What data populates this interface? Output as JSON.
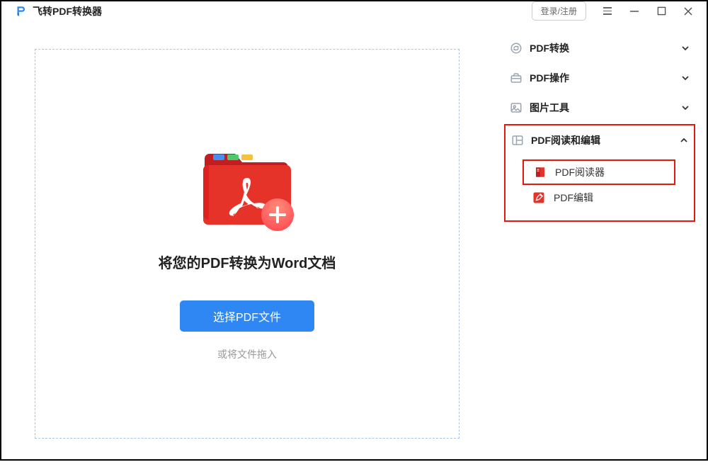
{
  "app": {
    "title": "飞转PDF转换器"
  },
  "titlebar": {
    "login": "登录/注册"
  },
  "main": {
    "heading": "将您的PDF转换为Word文档",
    "choose_button": "选择PDF文件",
    "drag_hint": "或将文件拖入"
  },
  "sidebar": {
    "items": [
      {
        "label": "PDF转换"
      },
      {
        "label": "PDF操作"
      },
      {
        "label": "图片工具"
      },
      {
        "label": "PDF阅读和编辑"
      }
    ],
    "sub": [
      {
        "label": "PDF阅读器"
      },
      {
        "label": "PDF编辑"
      }
    ]
  }
}
